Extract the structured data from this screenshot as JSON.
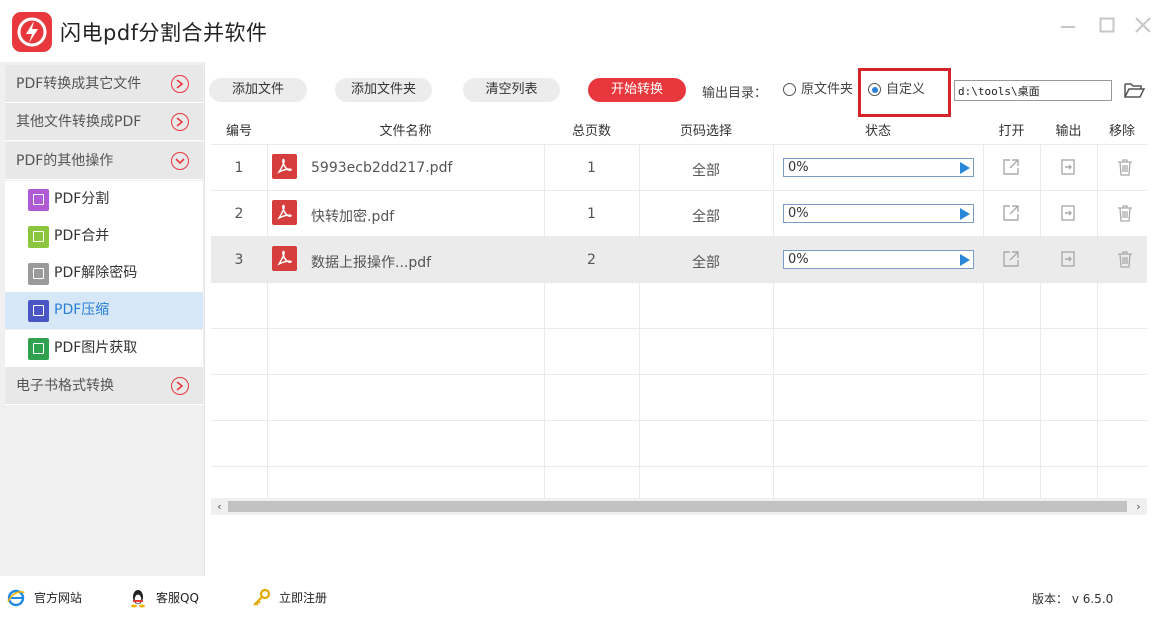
{
  "app": {
    "title": "闪电pdf分割合并软件",
    "accent": "#e8383d",
    "window_controls": [
      "minimize-icon",
      "maximize-icon",
      "close-icon"
    ]
  },
  "sidebar": {
    "categories": [
      {
        "label": "PDF转换成其它文件",
        "state": "collapsed"
      },
      {
        "label": "其他文件转换成PDF",
        "state": "collapsed"
      },
      {
        "label": "PDF的其他操作",
        "state": "expanded"
      },
      {
        "label": "电子书格式转换",
        "state": "collapsed"
      }
    ],
    "items": [
      {
        "label": "PDF分割",
        "icon": "split-icon",
        "color": "#b15ad6",
        "active": false
      },
      {
        "label": "PDF合并",
        "icon": "merge-icon",
        "color": "#8cc63f",
        "active": false
      },
      {
        "label": "PDF解除密码",
        "icon": "lock-icon",
        "color": "#9a9a9a",
        "active": false
      },
      {
        "label": "PDF压缩",
        "icon": "compress-icon",
        "color": "#4a56c6",
        "active": true
      },
      {
        "label": "PDF图片获取",
        "icon": "image-icon",
        "color": "#2fa14f",
        "active": false
      }
    ]
  },
  "toolbar": {
    "add_file": "添加文件",
    "add_folder": "添加文件夹",
    "clear_list": "清空列表",
    "start": "开始转换",
    "output_label": "输出目录：",
    "radio_original": "原文件夹",
    "radio_custom": "自定义",
    "selected_output": "自定义",
    "path_value": "d:\\tools\\桌面"
  },
  "table": {
    "columns": [
      "编号",
      "文件名称",
      "总页数",
      "页码选择",
      "状态",
      "打开",
      "输出",
      "移除"
    ],
    "rows": [
      {
        "no": "1",
        "name": "5993ecb2dd217.pdf",
        "pages": "1",
        "range": "全部",
        "status": "0%",
        "progress": 0,
        "selected": false
      },
      {
        "no": "2",
        "name": "快转加密.pdf",
        "pages": "1",
        "range": "全部",
        "status": "0%",
        "progress": 0,
        "selected": false
      },
      {
        "no": "3",
        "name": "数据上报操作...pdf",
        "pages": "2",
        "range": "全部",
        "status": "0%",
        "progress": 0,
        "selected": true
      }
    ]
  },
  "footer": {
    "website": "官方网站",
    "qq": "客服QQ",
    "register": "立即注册",
    "version": "版本： v 6.5.0"
  }
}
